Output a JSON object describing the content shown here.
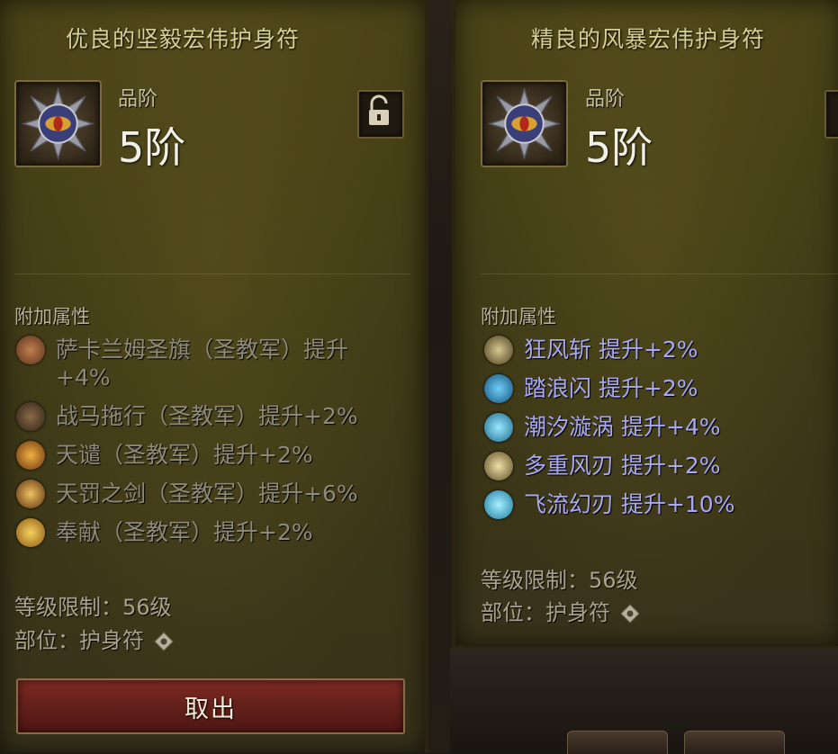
{
  "left_panel": {
    "title": "优良的坚毅宏伟护身符",
    "grade_label": "品阶",
    "grade_value": "5阶",
    "section_label": "附加属性",
    "attributes": [
      {
        "line1": "萨卡兰姆圣旗（圣教军）提升",
        "line2": "+4%",
        "icon": "banner-icon",
        "color": "#6a3f22"
      },
      {
        "line1": "战马拖行（圣教军）提升+2%",
        "icon": "steed-icon",
        "color": "#5a4430"
      },
      {
        "line1": "天谴（圣教军）提升+2%",
        "icon": "condemn-icon",
        "color": "#b06a1e"
      },
      {
        "line1": "天罚之剑（圣教军）提升+6%",
        "icon": "sword-icon",
        "color": "#9a6a28"
      },
      {
        "line1": "奉献（圣教军）提升+2%",
        "icon": "consecration-icon",
        "color": "#c08a1e"
      }
    ],
    "level_req": "等级限制：56级",
    "slot": "部位：护身符",
    "take_button": "取出"
  },
  "right_panel": {
    "title": "精良的风暴宏伟护身符",
    "grade_label": "品阶",
    "grade_value": "5阶",
    "section_label": "附加属性",
    "attributes": [
      {
        "line1": "狂风斩  提升+2%",
        "icon": "wind-slash-icon",
        "color": "#7a6a38"
      },
      {
        "line1": "踏浪闪  提升+2%",
        "icon": "wave-step-icon",
        "color": "#2f86b8"
      },
      {
        "line1": "潮汐漩涡  提升+4%",
        "icon": "tidal-vortex-icon",
        "color": "#3aa2c8"
      },
      {
        "line1": "多重风刃  提升+2%",
        "icon": "wind-blades-icon",
        "color": "#8a7a4a"
      },
      {
        "line1": "飞流幻刃  提升+10%",
        "icon": "flowing-blade-icon",
        "color": "#3db0d8"
      }
    ],
    "level_req": "等级限制：56级",
    "slot": "部位：护身符"
  }
}
